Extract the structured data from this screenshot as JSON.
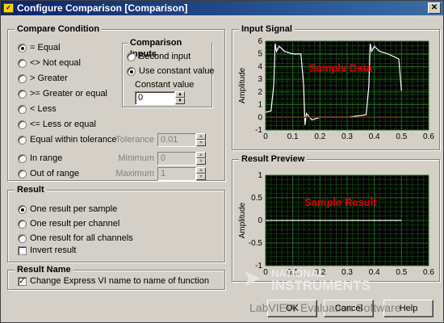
{
  "window": {
    "title": "Configure Comparison [Comparison]"
  },
  "compare_condition": {
    "title": "Compare Condition",
    "options": [
      {
        "label": "= Equal",
        "selected": true
      },
      {
        "label": "<> Not equal",
        "selected": false
      },
      {
        "label": "> Greater",
        "selected": false
      },
      {
        "label": ">= Greater or equal",
        "selected": false
      },
      {
        "label": "< Less",
        "selected": false
      },
      {
        "label": "<= Less or equal",
        "selected": false
      },
      {
        "label": "Equal within tolerance",
        "selected": false
      },
      {
        "label": "In range",
        "selected": false
      },
      {
        "label": "Out of range",
        "selected": false
      }
    ],
    "tolerance": {
      "label": "Tolerance",
      "value": "0.01"
    },
    "minimum": {
      "label": "Minimum",
      "value": "0"
    },
    "maximum": {
      "label": "Maximum",
      "value": "1"
    }
  },
  "comparison_inputs": {
    "title": "Comparison Inputs",
    "options": [
      {
        "label": "Second input",
        "selected": false
      },
      {
        "label": "Use constant value",
        "selected": true
      }
    ],
    "constant_label": "Constant value",
    "constant_value": "0"
  },
  "result": {
    "title": "Result",
    "options": [
      {
        "label": "One result per sample",
        "selected": true
      },
      {
        "label": "One result per channel",
        "selected": false
      },
      {
        "label": "One result for all channels",
        "selected": false
      }
    ],
    "invert_label": "Invert result",
    "invert_checked": false
  },
  "result_name": {
    "title": "Result Name",
    "change_label": "Change Express VI name to name of function",
    "change_checked": true
  },
  "input_signal": {
    "title": "Input Signal",
    "annotation": "Sample Data",
    "ylabel": "Amplitude",
    "yticks": [
      "6",
      "5",
      "4",
      "3",
      "2",
      "1",
      "0",
      "-1"
    ],
    "xticks": [
      "0",
      "0.1",
      "0.2",
      "0.3",
      "0.4",
      "0.5",
      "0.6"
    ]
  },
  "result_preview": {
    "title": "Result Preview",
    "annotation": "Sample Result",
    "ylabel": "Amplitude",
    "yticks": [
      "1",
      "0.5",
      "0",
      "-0.5",
      "-1"
    ],
    "xticks": [
      "0",
      "0.1",
      "0.2",
      "0.3",
      "0.4",
      "0.5",
      "0.6"
    ]
  },
  "buttons": {
    "ok": "OK",
    "cancel": "Cancel",
    "help": "Help"
  },
  "watermark": {
    "line1": "NATIONAL",
    "line2": "INSTRUMENTS",
    "line3": "LabVIEW Evaluation Software"
  },
  "colors": {
    "plot_bg": "#000000",
    "grid": "#1f6b1f",
    "trace": "#ffffff",
    "zero_line": "#c00000",
    "annotation": "#e00000"
  },
  "chart_data": [
    {
      "type": "line",
      "title": "Input Signal",
      "ylabel": "Amplitude",
      "xlim": [
        0,
        0.6
      ],
      "ylim": [
        -1,
        6
      ],
      "series": [
        {
          "x": [
            0.0,
            0.02,
            0.03,
            0.035,
            0.04,
            0.05,
            0.07,
            0.1,
            0.13,
            0.14,
            0.145,
            0.15,
            0.17,
            0.2,
            0.3,
            0.37,
            0.38,
            0.385,
            0.39,
            0.4,
            0.42,
            0.45,
            0.49,
            0.5
          ],
          "y": [
            0.4,
            0.5,
            2.5,
            5.8,
            5.2,
            5.6,
            5.2,
            5.0,
            5.0,
            2.5,
            -0.6,
            0.3,
            -0.2,
            0.0,
            0.0,
            0.2,
            2.5,
            5.8,
            5.2,
            5.6,
            5.2,
            5.0,
            4.6,
            2.1
          ]
        },
        {
          "x": [
            0.0,
            0.5
          ],
          "y": [
            0.0,
            0.0
          ]
        }
      ]
    },
    {
      "type": "line",
      "title": "Result Preview",
      "ylabel": "Amplitude",
      "xlim": [
        0,
        0.6
      ],
      "ylim": [
        -1,
        1
      ],
      "series": [
        {
          "x": [
            0.0,
            0.5
          ],
          "y": [
            0.0,
            0.0
          ]
        }
      ]
    }
  ]
}
